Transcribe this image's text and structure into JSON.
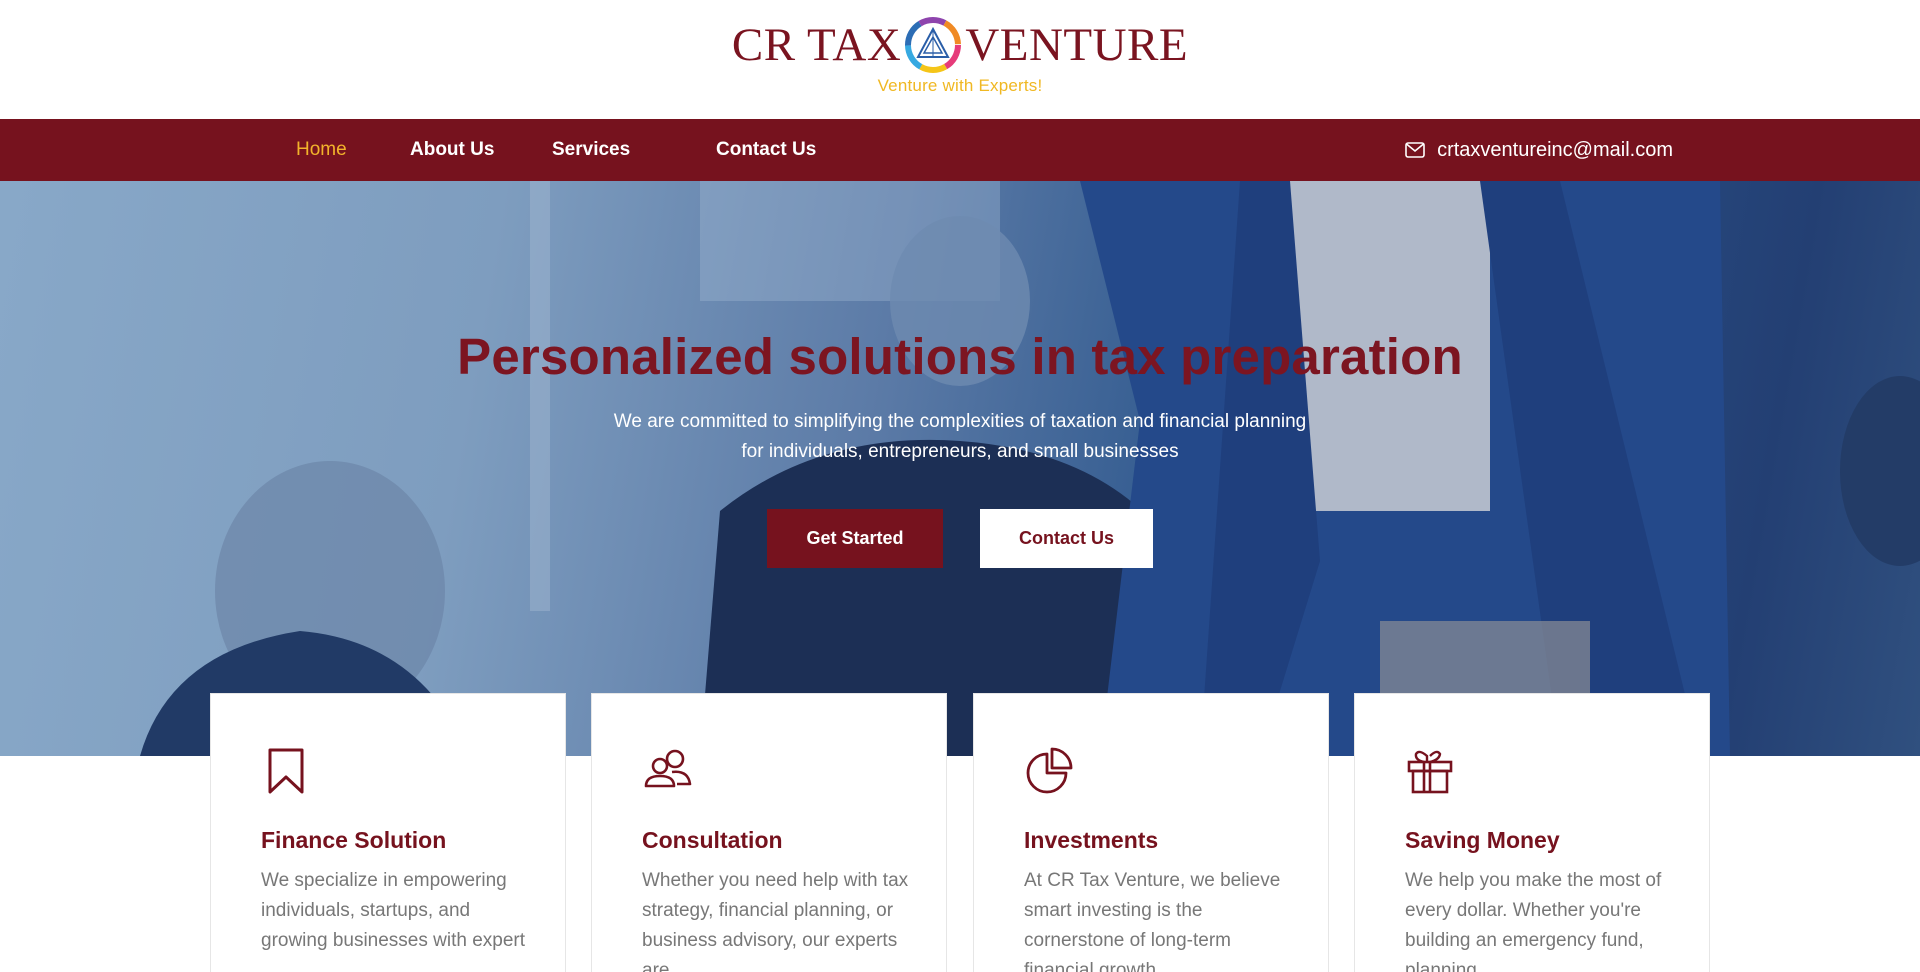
{
  "brand": {
    "name_left": "CR TAX",
    "name_right": "VENTURE",
    "tagline": "Venture with Experts!",
    "logo_icon": "triangle-emblem-icon",
    "color_primary": "#76121e",
    "color_accent": "#f2b32b"
  },
  "nav": {
    "items": [
      {
        "label": "Home",
        "active": true
      },
      {
        "label": "About Us",
        "active": false
      },
      {
        "label": "Services",
        "active": false
      },
      {
        "label": "Contact Us",
        "active": false
      }
    ],
    "email": "crtaxventureinc@mail.com",
    "email_icon": "envelope-icon"
  },
  "hero": {
    "title": "Personalized solutions in tax preparation",
    "subtitle_line1": "We are committed to simplifying the complexities of taxation and financial planning",
    "subtitle_line2": "for individuals, entrepreneurs, and small businesses",
    "primary_button": "Get Started",
    "secondary_button": "Contact Us"
  },
  "cards": [
    {
      "icon": "bookmark-icon",
      "title": "Finance Solution",
      "text": "We specialize in empowering individuals, startups, and growing businesses with expert"
    },
    {
      "icon": "users-icon",
      "title": "Consultation",
      "text": "Whether you need help with tax strategy, financial planning, or business advisory, our experts are"
    },
    {
      "icon": "pie-chart-icon",
      "title": "Investments",
      "text": "At CR Tax Venture, we believe smart investing is the cornerstone of long-term financial growth."
    },
    {
      "icon": "gift-icon",
      "title": "Saving Money",
      "text": "We help you make the most of every dollar. Whether you're building an emergency fund, planning"
    }
  ]
}
